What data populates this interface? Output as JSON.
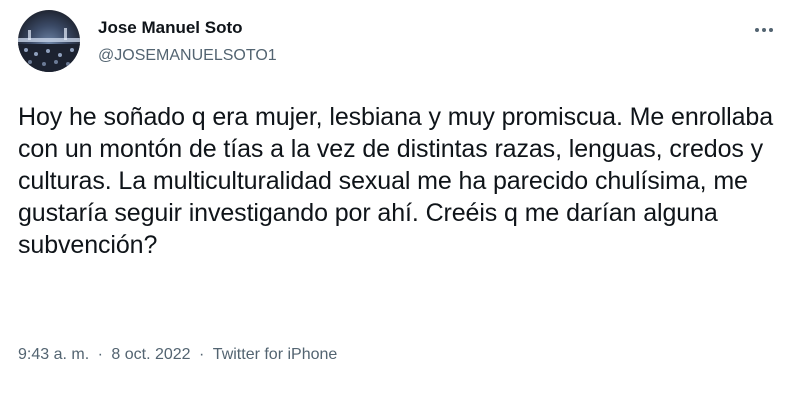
{
  "author": {
    "name": "Jose Manuel Soto",
    "handle": "@JOSEMANUELSOTO1"
  },
  "tweet": {
    "text": "Hoy he soñado q era mujer, lesbiana y muy promiscua. Me enrollaba con un montón de tías a la vez de distintas razas, lenguas, credos y culturas. La multiculturalidad sexual me ha parecido chulísima, me gustaría seguir investigando por ahí. Creéis q me darían alguna subvención?"
  },
  "meta": {
    "time": "9:43 a. m.",
    "separator": "·",
    "date": "8 oct. 2022",
    "source": "Twitter for iPhone"
  },
  "icons": {
    "more": "more-horizontal-icon"
  }
}
